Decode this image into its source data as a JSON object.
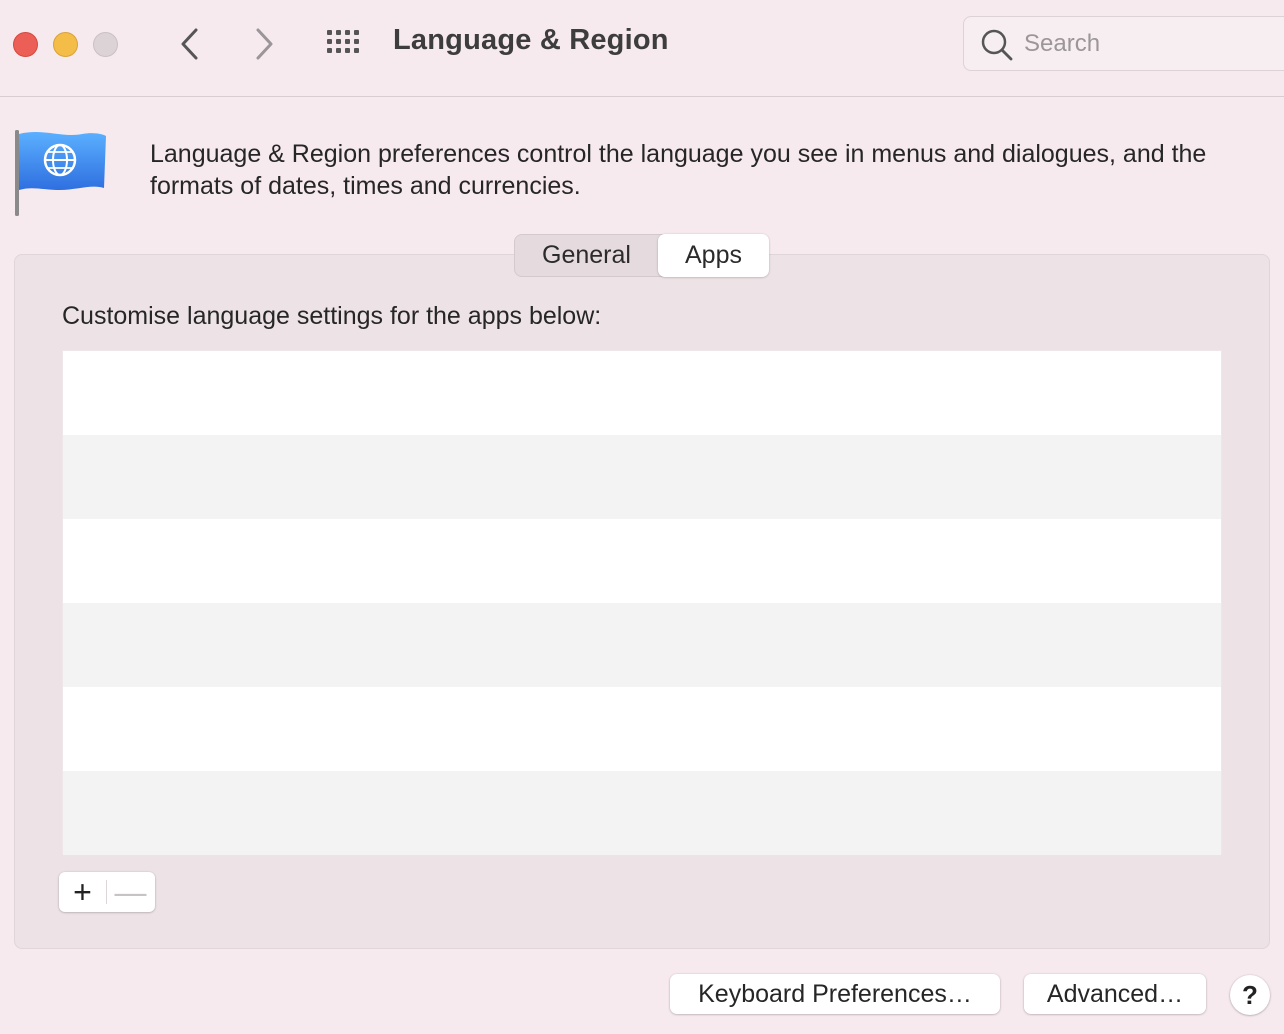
{
  "window": {
    "title": "Language & Region"
  },
  "toolbar": {
    "back_icon": "chevron-left",
    "forward_icon": "chevron-right",
    "show_all_icon": "grid-dots"
  },
  "search": {
    "placeholder": "Search",
    "value": ""
  },
  "header": {
    "icon": "globe-flag",
    "description": "Language & Region preferences control the language you see in menus and dialogues, and the formats of dates, times and currencies."
  },
  "tabs": [
    {
      "label": "General",
      "selected": false
    },
    {
      "label": "Apps",
      "selected": true
    }
  ],
  "apps_panel": {
    "label": "Customise language settings for the apps below:",
    "apps": [],
    "add_label": "+",
    "remove_label": "—"
  },
  "footer": {
    "keyboard_label": "Keyboard Preferences…",
    "advanced_label": "Advanced…",
    "help_label": "?"
  },
  "colors": {
    "close": "#ec5f57",
    "minimize": "#f3bd48",
    "zoom_disabled": "#dcd3d6",
    "window_bg": "#f6eaee",
    "flag_blue": "#3b8af0"
  }
}
